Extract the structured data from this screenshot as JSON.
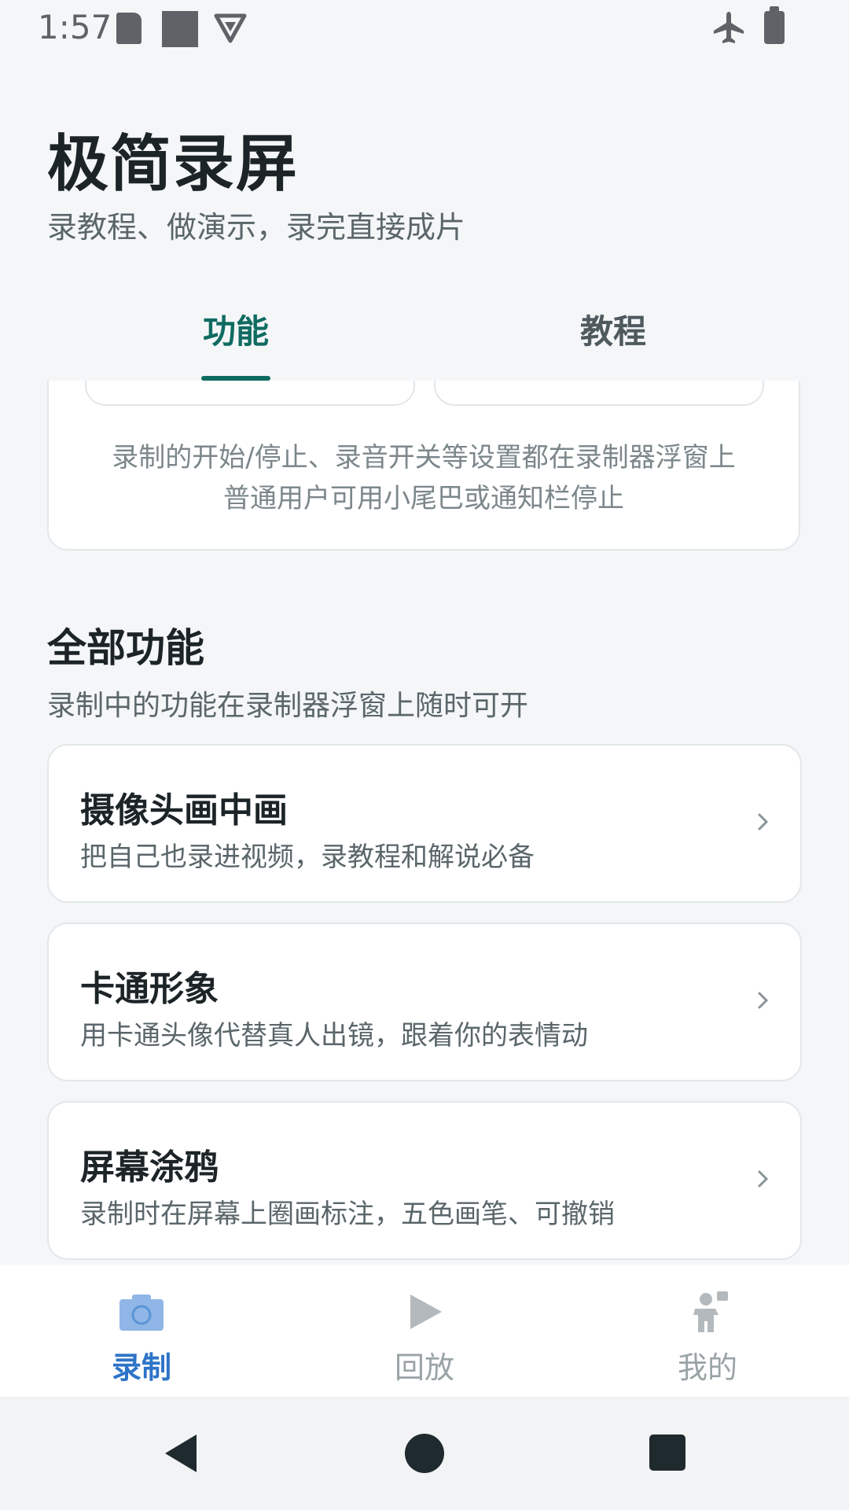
{
  "status_bar": {
    "time": "1:57",
    "left_icons": [
      "sd-card-icon",
      "square-icon",
      "vpn-icon"
    ],
    "right_icons": [
      "airplane-icon",
      "battery-icon"
    ]
  },
  "header": {
    "title": "极简录屏",
    "subtitle": "录教程、做演示，录完直接成片"
  },
  "tabs": [
    {
      "label": "功能",
      "active": true
    },
    {
      "label": "教程",
      "active": false
    }
  ],
  "info_card": {
    "line1": "录制的开始/停止、录音开关等设置都在录制器浮窗上",
    "line2": "普通用户可用小尾巴或通知栏停止"
  },
  "all_features": {
    "title": "全部功能",
    "description": "录制中的功能在录制器浮窗上随时可开",
    "items": [
      {
        "title": "摄像头画中画",
        "description": "把自己也录进视频，录教程和解说必备"
      },
      {
        "title": "卡通形象",
        "description": "用卡通头像代替真人出镜，跟着你的表情动"
      },
      {
        "title": "屏幕涂鸦",
        "description": "录制时在屏幕上圈画标注，五色画笔、可撤销"
      }
    ]
  },
  "bottom_nav": {
    "items": [
      {
        "label": "录制",
        "icon": "camera-icon",
        "active": true
      },
      {
        "label": "回放",
        "icon": "play-icon",
        "active": false
      },
      {
        "label": "我的",
        "icon": "person-icon",
        "active": false
      }
    ],
    "colors": {
      "active": "#2d74c8",
      "inactive": "#9aa3a6"
    }
  },
  "system_nav": [
    "back-icon",
    "home-icon",
    "recents-icon"
  ],
  "colors": {
    "accent": "#0f6b61",
    "background": "#f4f6f8"
  }
}
